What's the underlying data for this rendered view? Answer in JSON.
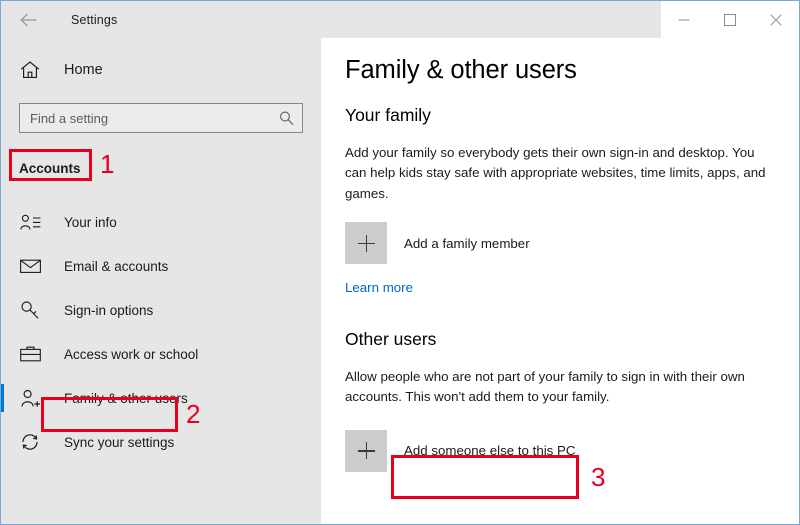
{
  "window": {
    "title": "Settings",
    "back_icon": "back-arrow-icon",
    "controls": [
      {
        "name": "minimize-button",
        "glyph": "minimize-icon"
      },
      {
        "name": "maximize-button",
        "glyph": "maximize-icon"
      },
      {
        "name": "close-button",
        "glyph": "close-icon"
      }
    ]
  },
  "sidebar": {
    "home": {
      "label": "Home",
      "icon": "home-icon"
    },
    "search": {
      "placeholder": "Find a setting",
      "value": "",
      "icon": "search-icon"
    },
    "category": "Accounts",
    "items": [
      {
        "label": "Your info",
        "icon": "user-info-icon",
        "selected": false
      },
      {
        "label": "Email & accounts",
        "icon": "envelope-icon",
        "selected": false
      },
      {
        "label": "Sign-in options",
        "icon": "key-icon",
        "selected": false
      },
      {
        "label": "Access work or school",
        "icon": "briefcase-icon",
        "selected": false
      },
      {
        "label": "Family & other users",
        "icon": "add-user-icon",
        "selected": true
      },
      {
        "label": "Sync your settings",
        "icon": "sync-icon",
        "selected": false
      }
    ]
  },
  "main": {
    "page_title": "Family & other users",
    "sections": [
      {
        "heading": "Your family",
        "body": "Add your family so everybody gets their own sign-in and desktop. You can help kids stay safe with appropriate websites, time limits, apps, and games.",
        "action_label": "Add a family member",
        "link_label": "Learn more"
      },
      {
        "heading": "Other users",
        "body": "Allow people who are not part of your family to sign in with their own accounts. This won't add them to your family.",
        "action_label": "Add someone else to this PC"
      }
    ]
  },
  "annotations": {
    "color": "#e8001c",
    "markers": [
      {
        "number": "1",
        "target": "Accounts"
      },
      {
        "number": "2",
        "target": "Family & other users"
      },
      {
        "number": "3",
        "target": "Add someone else to this PC"
      }
    ]
  },
  "colors": {
    "accent": "#0078d7",
    "link": "#0066cc",
    "sidebar_bg": "#e6e6e6",
    "content_bg": "#ffffff",
    "annotation_red": "#e8001c",
    "window_border": "#7ba7d7"
  }
}
